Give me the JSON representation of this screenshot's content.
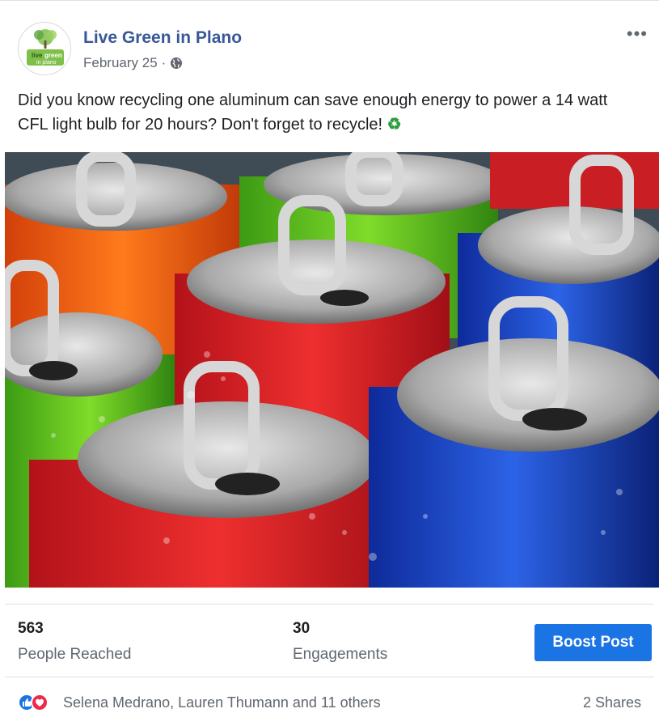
{
  "post": {
    "page_name": "Live Green in Plano",
    "avatar_text": [
      "live",
      "green",
      "in plano"
    ],
    "date": "February 25",
    "separator": "·",
    "audience_icon": "globe-icon",
    "more_icon": "more-options-icon",
    "more_label": "•••",
    "text": "Did you know recycling one aluminum can save enough energy to power a 14 watt CFL light bulb for 20 hours? Don't forget to recycle!",
    "text_emoji": "♻",
    "image_description_icon": "photo"
  },
  "insights": {
    "reach_value": "563",
    "reach_label": "People Reached",
    "engagement_value": "30",
    "engagement_label": "Engagements",
    "boost_label": "Boost Post"
  },
  "footer": {
    "reaction_icons": [
      "like-icon",
      "love-icon"
    ],
    "reactors_text": "Selena Medrano, Lauren Thumann and 11 others",
    "shares_text": "2 Shares"
  },
  "colors": {
    "link_blue": "#385898",
    "boost_blue": "#1b74e4",
    "love_red": "#f0284a",
    "recycle_green": "#2e9b3f"
  }
}
